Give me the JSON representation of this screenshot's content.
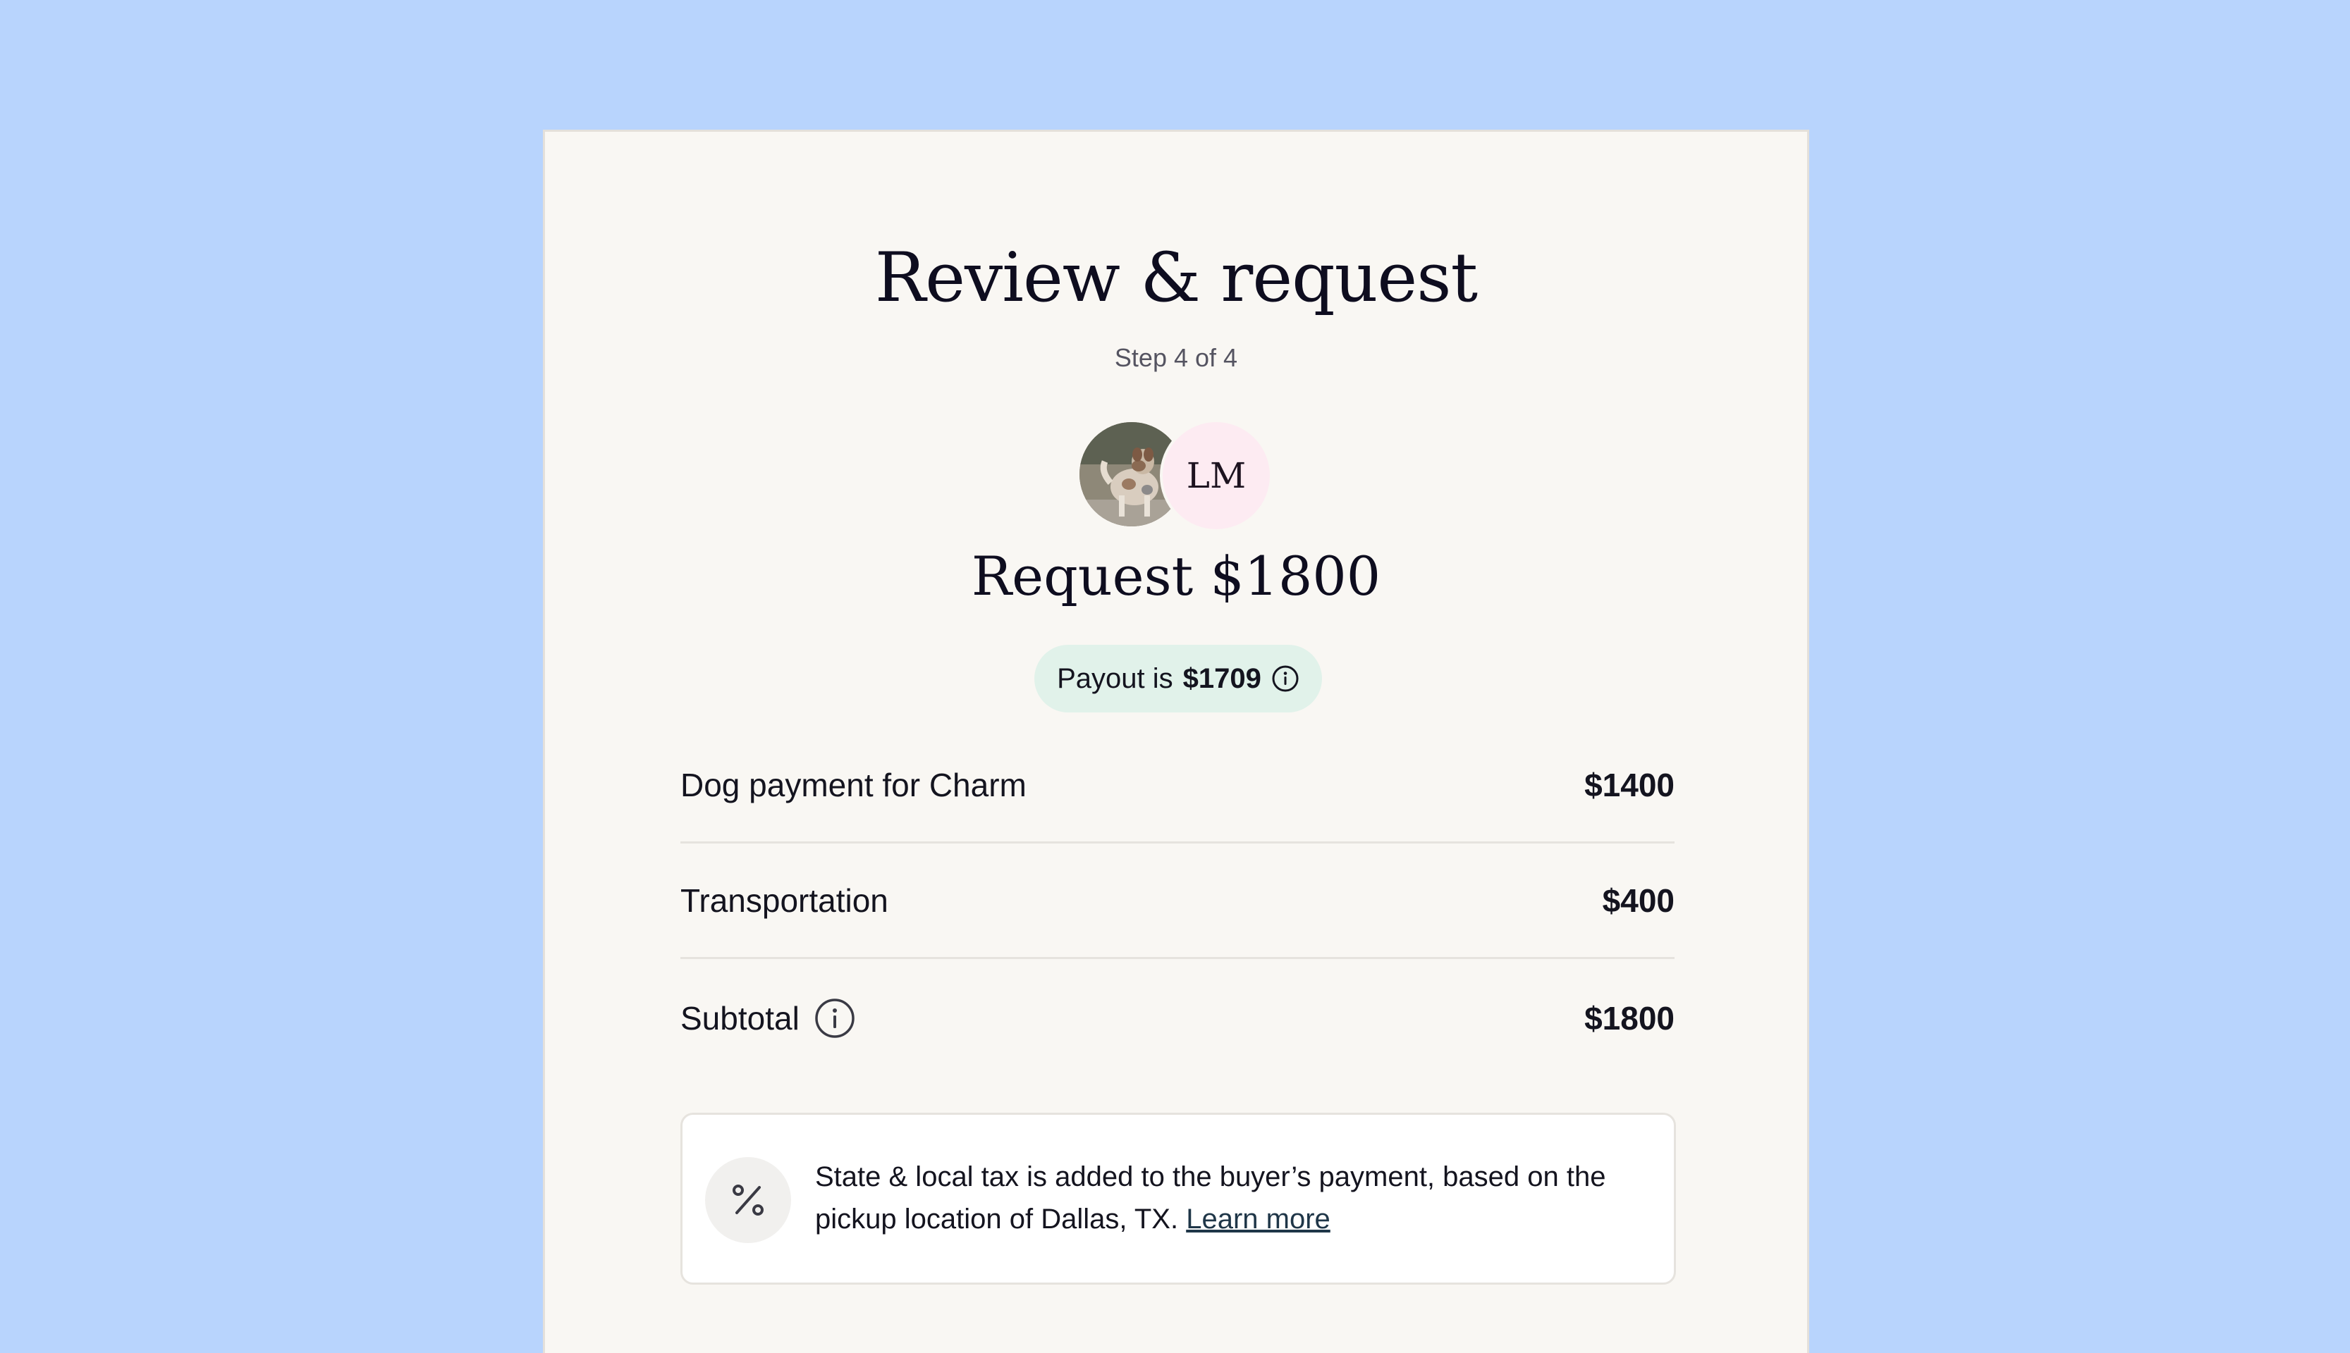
{
  "header": {
    "title": "Review & request",
    "step": "Step 4 of 4"
  },
  "avatars": {
    "pet_photo_icon": "dog-photo",
    "buyer_initials": "LM"
  },
  "request": {
    "amount_label": "Request $1800"
  },
  "payout": {
    "prefix": "Payout is",
    "amount": "$1709",
    "icon": "info-icon",
    "colors": {
      "background": "#e1f2ea"
    }
  },
  "line_items": [
    {
      "label": "Dog payment for Charm",
      "value": "$1400"
    },
    {
      "label": "Transportation",
      "value": "$400"
    }
  ],
  "subtotal": {
    "label": "Subtotal",
    "value": "$1800",
    "icon": "info-icon"
  },
  "tax_notice": {
    "icon": "percent-icon",
    "text": "State & local tax is added to the buyer’s payment, based on the pickup location of Dallas, TX.",
    "link_text": "Learn more"
  },
  "colors": {
    "page_background": "#b8d4fd",
    "card_background": "#f9f7f3",
    "initials_avatar_background": "#fdebf2"
  }
}
